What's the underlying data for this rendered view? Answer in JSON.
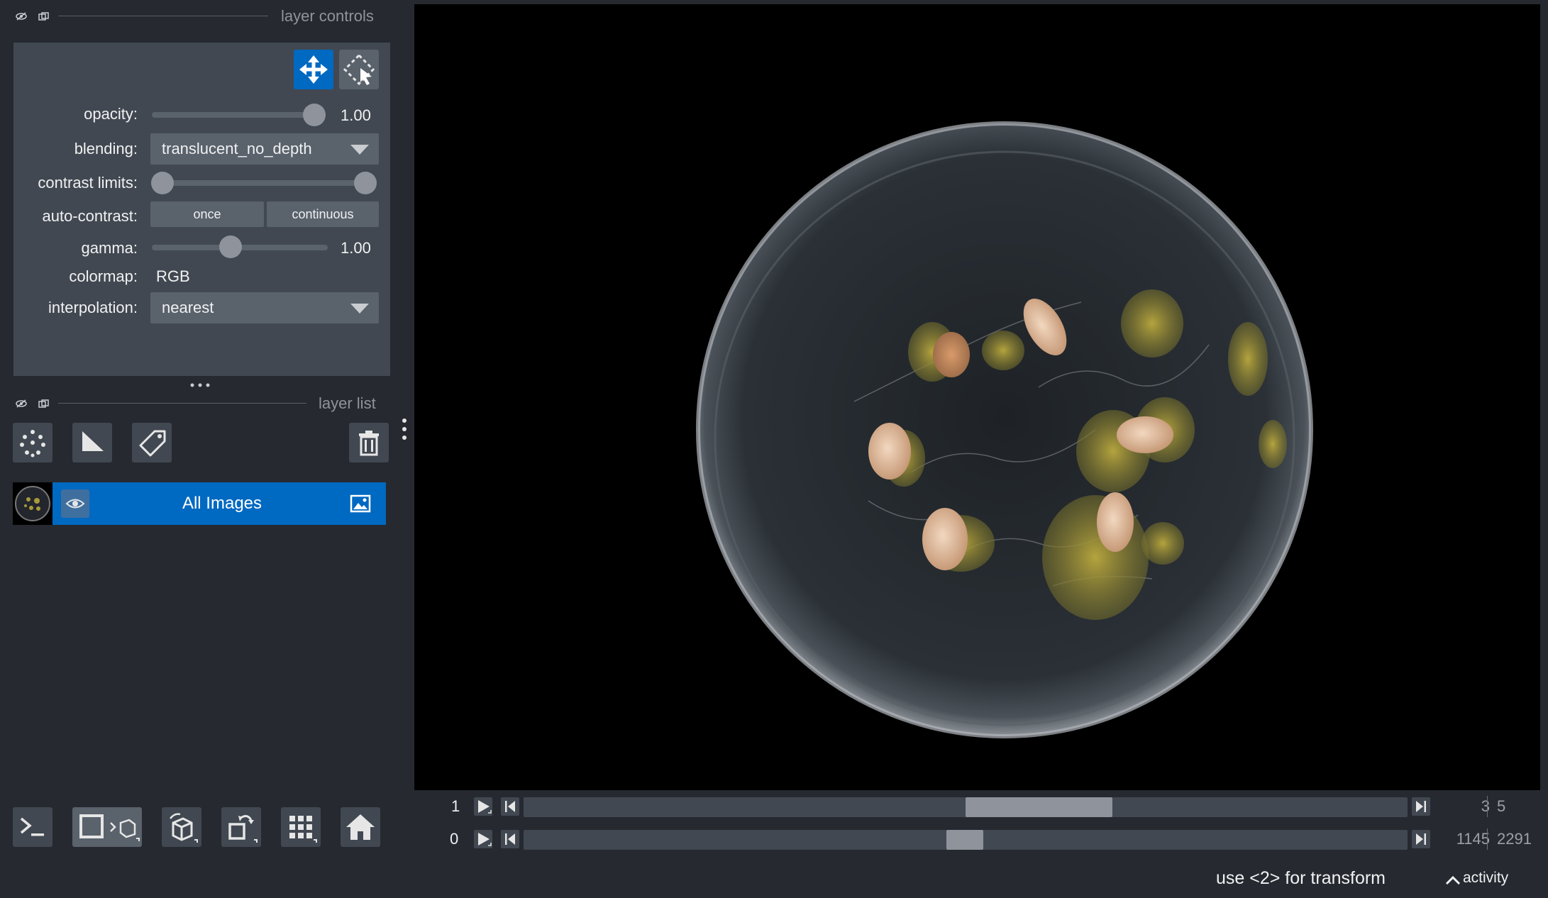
{
  "layer_controls": {
    "title": "layer controls",
    "opacity": {
      "label": "opacity:",
      "value": "1.00"
    },
    "blending": {
      "label": "blending:",
      "value": "translucent_no_depth"
    },
    "contrast_limits": {
      "label": "contrast limits:"
    },
    "auto_contrast": {
      "label": "auto-contrast:",
      "once": "once",
      "continuous": "continuous"
    },
    "gamma": {
      "label": "gamma:",
      "value": "1.00"
    },
    "colormap": {
      "label": "colormap:",
      "value": "RGB"
    },
    "interpolation": {
      "label": "interpolation:",
      "value": "nearest"
    }
  },
  "layer_list": {
    "title": "layer list",
    "layers": [
      {
        "name": "All Images"
      }
    ]
  },
  "dims": [
    {
      "axis_label": "1",
      "current": "3",
      "total": "5"
    },
    {
      "axis_label": "0",
      "current": "1145",
      "total": "2291"
    }
  ],
  "status": {
    "message": "use <2> for transform",
    "activity": "activity"
  },
  "colors": {
    "accent": "#0069c1",
    "panel_bg": "#262930",
    "control_bg": "#414851"
  }
}
